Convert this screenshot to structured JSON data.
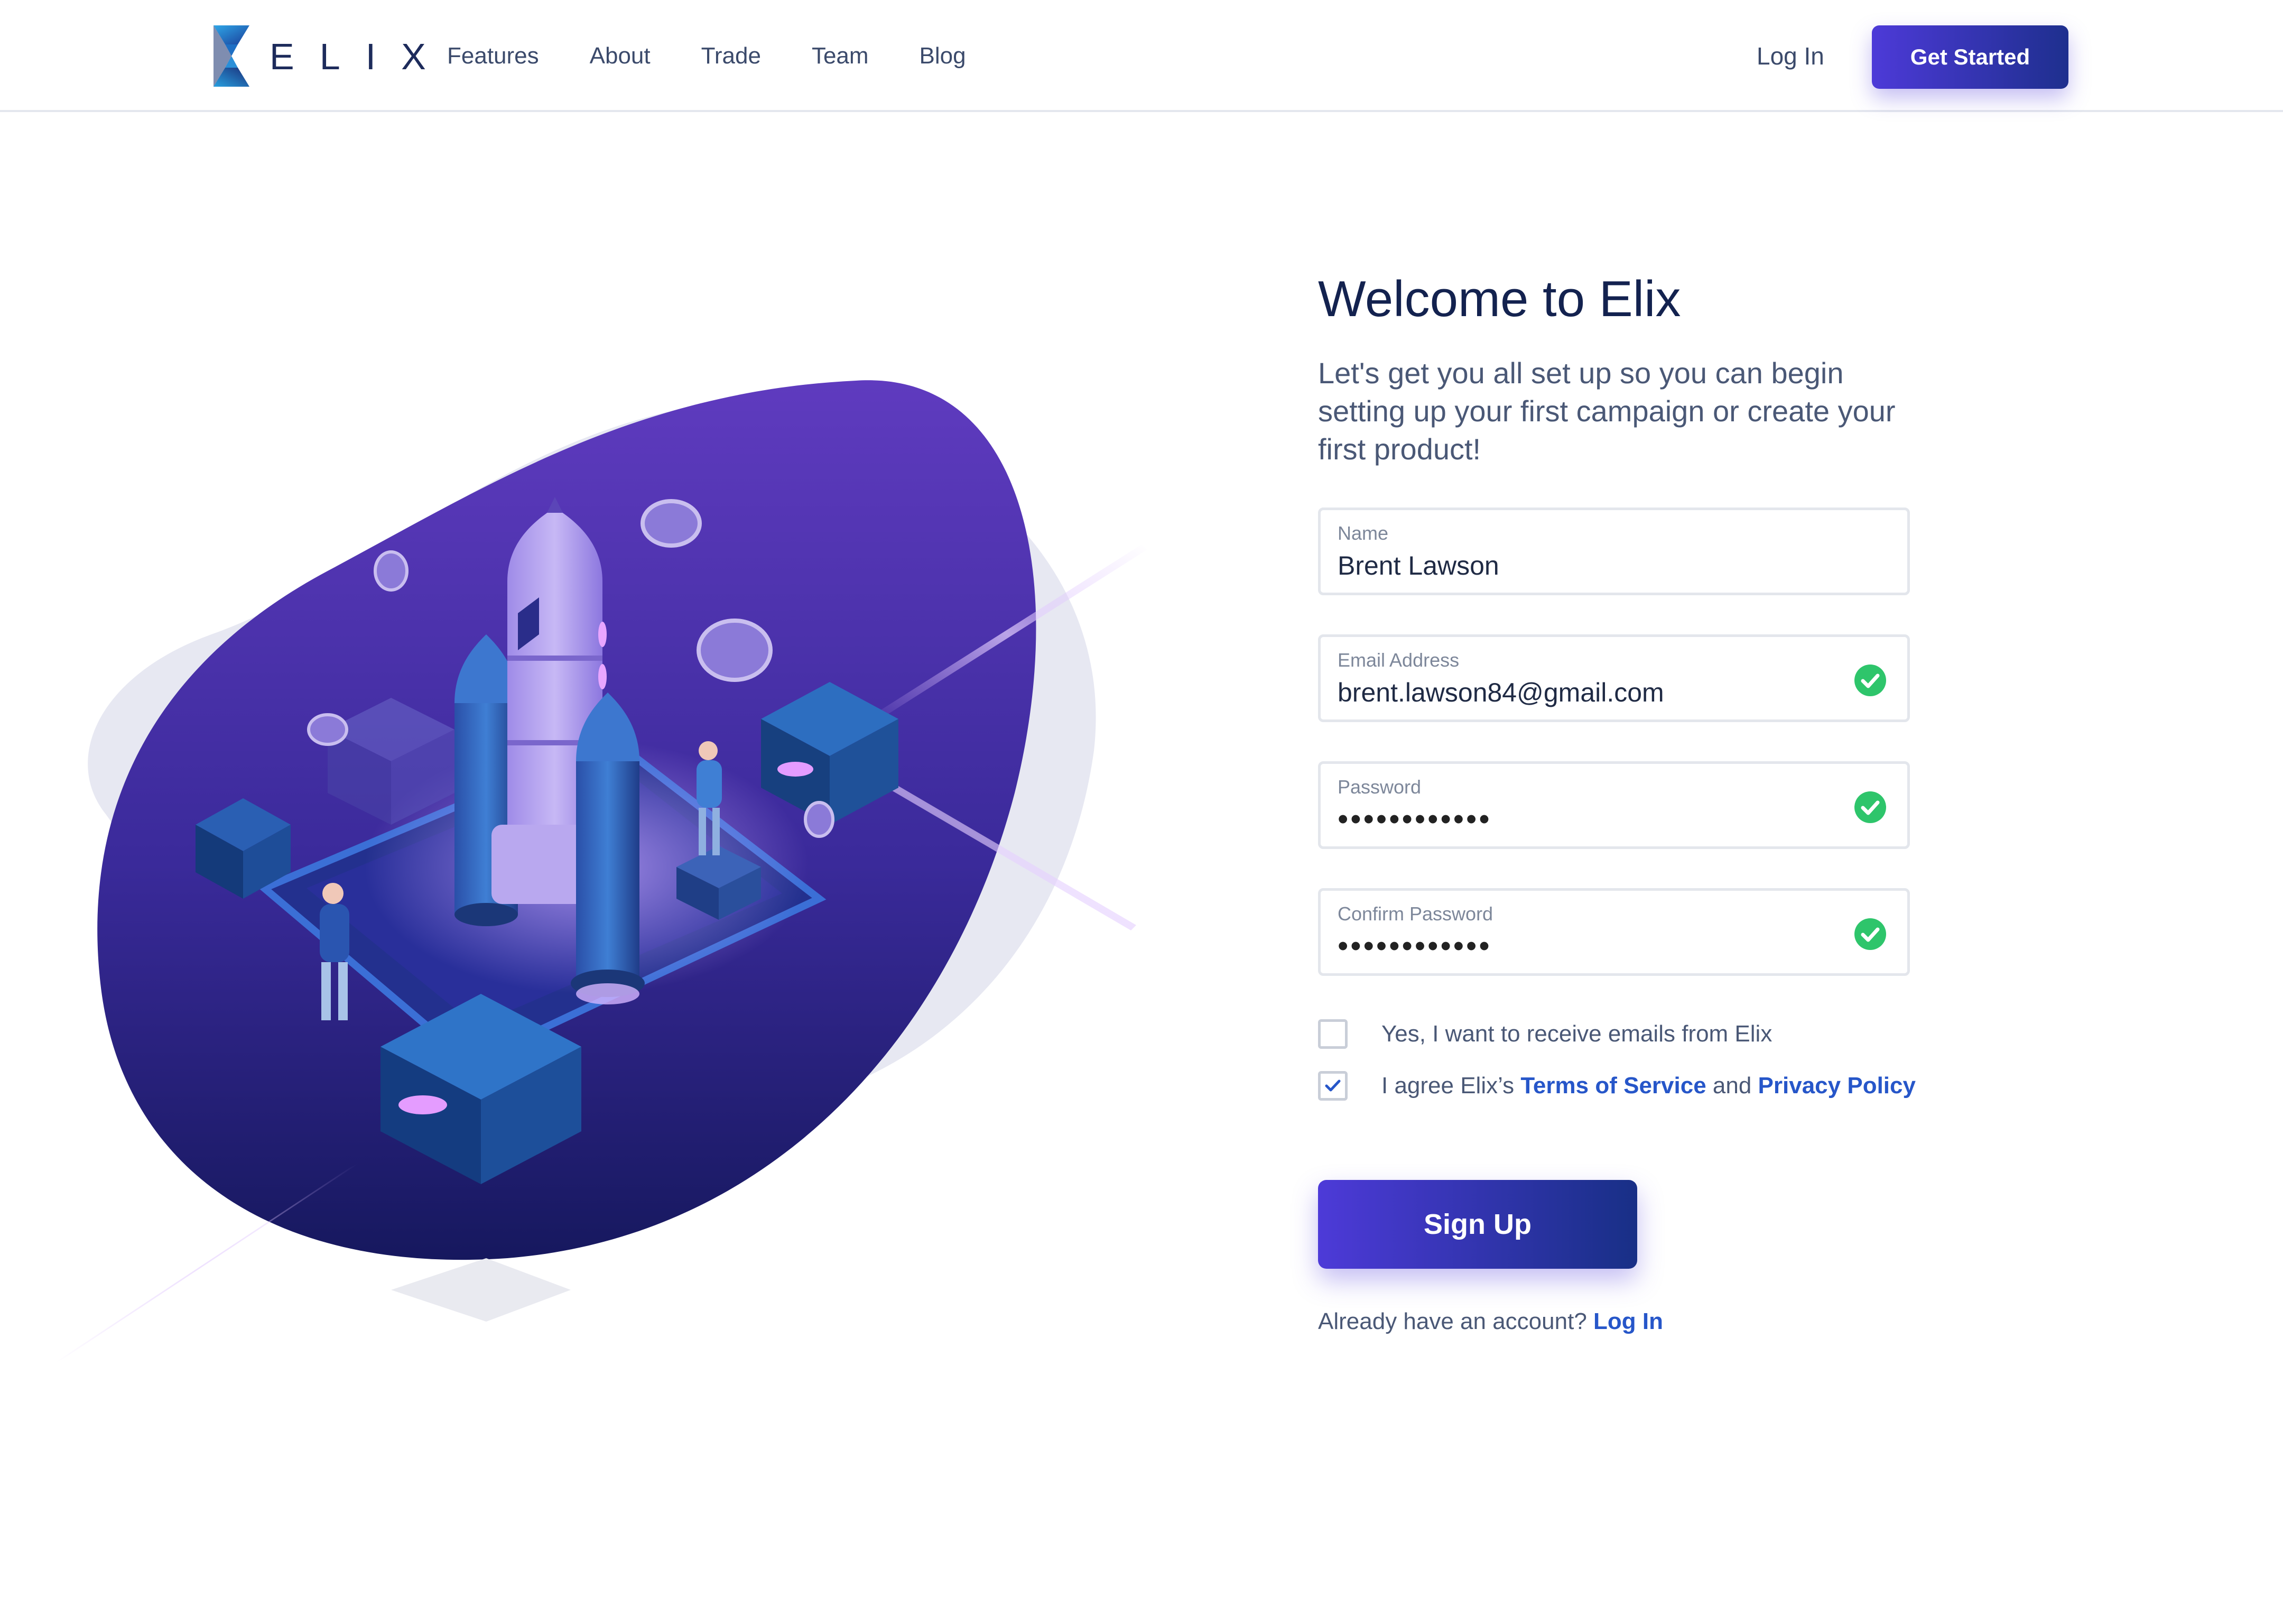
{
  "brand": {
    "name": "ELIX",
    "accent_color": "#4d3ad8",
    "gradient_end": "#1e2f8e",
    "link_color": "#2656c9",
    "success_color": "#2ec56b"
  },
  "nav": {
    "items": [
      {
        "label": "Features"
      },
      {
        "label": "About"
      },
      {
        "label": "Trade"
      },
      {
        "label": "Team"
      },
      {
        "label": "Blog"
      }
    ],
    "login_label": "Log In",
    "cta_label": "Get Started"
  },
  "illustration": {
    "icon": "rocket-launch-illustration"
  },
  "form": {
    "title": "Welcome to Elix",
    "subtitle": "Let's get you all set up so you can begin setting up your first campaign or create your first product!",
    "fields": {
      "name": {
        "label": "Name",
        "value": "Brent Lawson",
        "valid": false
      },
      "email": {
        "label": "Email Address",
        "value": "brent.lawson84@gmail.com",
        "valid": true
      },
      "password": {
        "label": "Password",
        "value": "••••••••••••",
        "valid": true
      },
      "confirm_password": {
        "label": "Confirm Password",
        "value": "••••••••••••",
        "valid": true
      }
    },
    "newsletter": {
      "label": "Yes, I want to receive emails from Elix",
      "checked": false
    },
    "terms": {
      "prefix": "I agree Elix’s ",
      "terms_link": "Terms of Service",
      "middle": " and ",
      "privacy_link": "Privacy Policy",
      "checked": true
    },
    "submit_label": "Sign Up",
    "already_text": "Already have an account? ",
    "login_link": "Log In"
  }
}
